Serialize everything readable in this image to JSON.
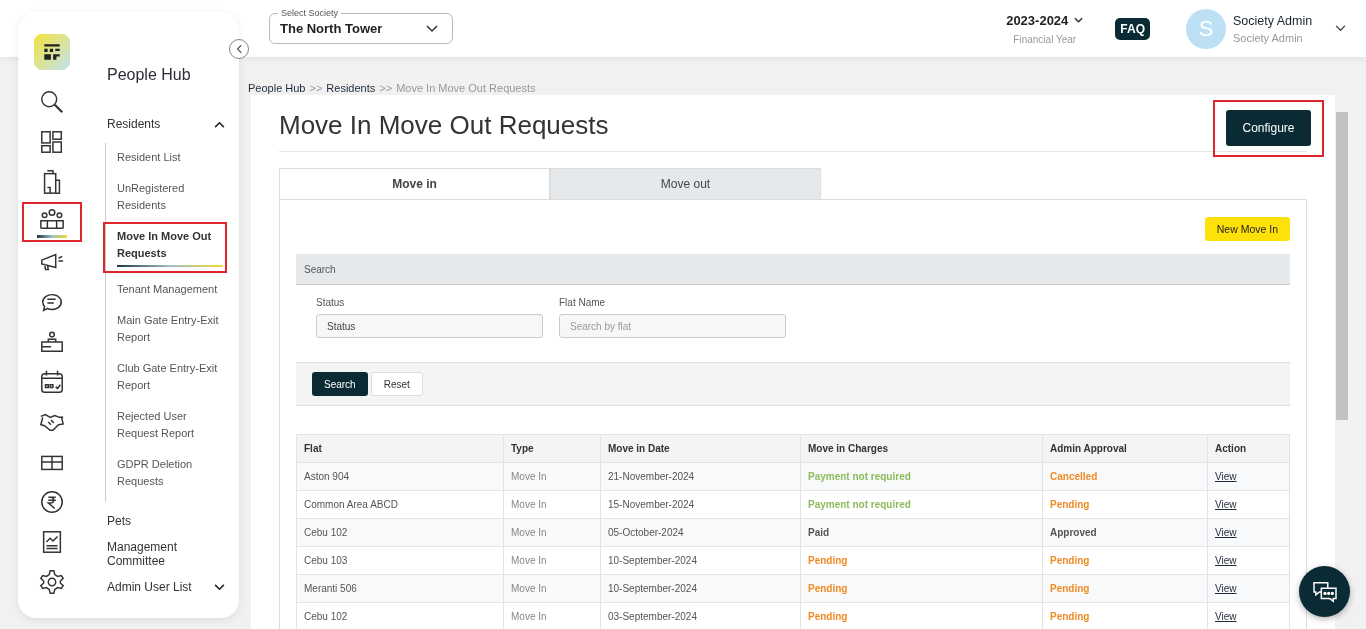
{
  "topbar": {
    "society_select": {
      "label": "Select Society",
      "value": "The North Tower"
    },
    "financial_year": {
      "value": "2023-2024",
      "caption": "Financial Year"
    },
    "faq": "FAQ",
    "user": {
      "initial": "S",
      "name": "Society Admin",
      "role": "Society Admin"
    }
  },
  "rail": [
    {
      "kind": "search",
      "selected": false,
      "annotated": false
    },
    {
      "kind": "dashboard",
      "selected": false,
      "annotated": false
    },
    {
      "kind": "building",
      "selected": false,
      "annotated": false
    },
    {
      "kind": "people",
      "selected": true,
      "annotated": true
    },
    {
      "kind": "megaphone",
      "selected": false,
      "annotated": false
    },
    {
      "kind": "chat",
      "selected": false,
      "annotated": false
    },
    {
      "kind": "desk",
      "selected": false,
      "annotated": false
    },
    {
      "kind": "calendar",
      "selected": false,
      "annotated": false
    },
    {
      "kind": "handshake",
      "selected": false,
      "annotated": false
    },
    {
      "kind": "box",
      "selected": false,
      "annotated": false
    },
    {
      "kind": "rupee",
      "selected": false,
      "annotated": false
    },
    {
      "kind": "report",
      "selected": false,
      "annotated": false
    },
    {
      "kind": "settings",
      "selected": false,
      "annotated": false
    }
  ],
  "nav": {
    "title": "People Hub",
    "items": [
      {
        "label": "Residents",
        "expanded": true,
        "children": [
          {
            "label": "Resident List",
            "selected": false,
            "annotated": false
          },
          {
            "label": "UnRegistered Residents",
            "selected": false,
            "annotated": false
          },
          {
            "label": "Move In Move Out Requests",
            "selected": true,
            "annotated": true
          },
          {
            "label": "Tenant Management",
            "selected": false,
            "annotated": false
          },
          {
            "label": "Main Gate Entry-Exit Report",
            "selected": false,
            "annotated": false
          },
          {
            "label": "Club Gate Entry-Exit Report",
            "selected": false,
            "annotated": false
          },
          {
            "label": "Rejected User Request Report",
            "selected": false,
            "annotated": false
          },
          {
            "label": "GDPR Deletion Requests",
            "selected": false,
            "annotated": false
          }
        ]
      },
      {
        "label": "Pets"
      },
      {
        "label": "Management Committee"
      },
      {
        "label": "Admin User List",
        "expanded": false
      }
    ]
  },
  "breadcrumb": [
    {
      "kind": "link",
      "text": "People Hub"
    },
    {
      "kind": "separator",
      "text": ">>"
    },
    {
      "kind": "link",
      "text": "Residents"
    },
    {
      "kind": "separator",
      "text": ">>"
    },
    {
      "kind": "current",
      "text": "Move In Move Out Requests"
    }
  ],
  "page": {
    "title": "Move In Move Out Requests",
    "configure_button": "Configure",
    "configure_annotated": true
  },
  "tabs": [
    {
      "label": "Move in",
      "selected": true
    },
    {
      "label": "Move out",
      "selected": false
    }
  ],
  "new_button": "New Move In",
  "search": {
    "title": "Search",
    "fields": [
      {
        "label": "Status",
        "value": "Status"
      },
      {
        "label": "Flat Name",
        "placeholder": "Search by flat"
      }
    ],
    "buttons": [
      {
        "label": "Search",
        "kind": "primary"
      },
      {
        "label": "Reset",
        "kind": "secondary"
      }
    ]
  },
  "table": {
    "columns": [
      "Flat",
      "Type",
      "Move in Date",
      "Move in Charges",
      "Admin Approval",
      "Action"
    ],
    "rows": [
      {
        "flat": "Aston 904",
        "type": "Move In",
        "date": "21-November-2024",
        "charges": {
          "text": "Payment not required",
          "color": "#8dbb5c"
        },
        "approval": {
          "text": "Cancelled",
          "color": "#f08a24"
        },
        "action": "View"
      },
      {
        "flat": "Common Area ABCD",
        "type": "Move In",
        "date": "15-November-2024",
        "charges": {
          "text": "Payment not required",
          "color": "#8dbb5c"
        },
        "approval": {
          "text": "Pending",
          "color": "#f08a24"
        },
        "action": "View"
      },
      {
        "flat": "Cebu 102",
        "type": "Move In",
        "date": "05-October-2024",
        "charges": {
          "text": "Paid",
          "color": "#555555"
        },
        "approval": {
          "text": "Approved",
          "color": "#555555"
        },
        "action": "View"
      },
      {
        "flat": "Cebu 103",
        "type": "Move In",
        "date": "10-September-2024",
        "charges": {
          "text": "Pending",
          "color": "#f08a24"
        },
        "approval": {
          "text": "Pending",
          "color": "#f08a24"
        },
        "action": "View"
      },
      {
        "flat": "Meranti 506",
        "type": "Move In",
        "date": "10-September-2024",
        "charges": {
          "text": "Pending",
          "color": "#f08a24"
        },
        "approval": {
          "text": "Pending",
          "color": "#f08a24"
        },
        "action": "View"
      },
      {
        "flat": "Cebu 102",
        "type": "Move In",
        "date": "03-September-2024",
        "charges": {
          "text": "Pending",
          "color": "#f08a24"
        },
        "approval": {
          "text": "Pending",
          "color": "#f08a24"
        },
        "action": "View"
      }
    ]
  }
}
